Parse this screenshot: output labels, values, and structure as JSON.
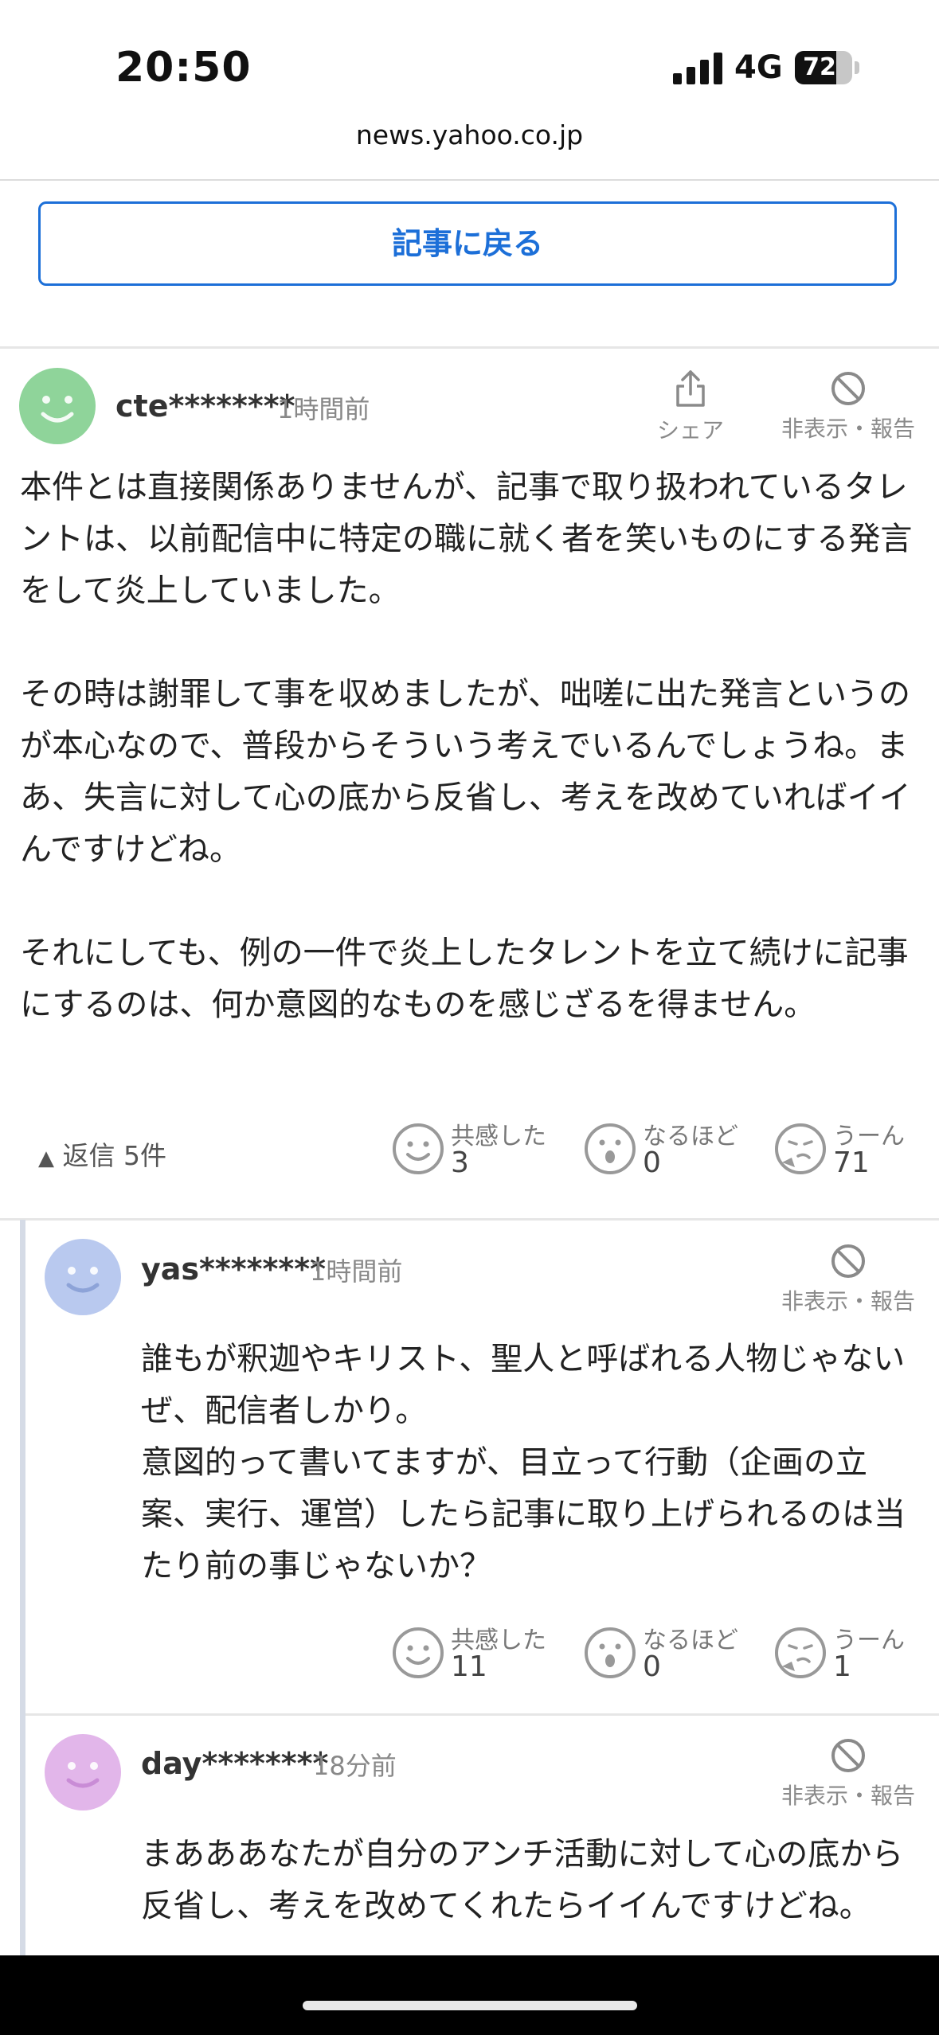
{
  "status_bar": {
    "time": "20:50",
    "network": "4G",
    "battery": "72",
    "battery_level": 0.72
  },
  "browser": {
    "url": "news.yahoo.co.jp"
  },
  "back_button": "記事に戻る",
  "comment": {
    "user": "cte********",
    "time_ago": "1時間前",
    "share_label": "シェア",
    "hide_report_label": "非表示・報告",
    "avatar_color": "#8fd49a",
    "text": "本件とは直接関係ありませんが、記事で取り扱われているタレントは、以前配信中に特定の職に就く者を笑いものにする発言をして炎上していました。\n\nその時は謝罪して事を収めましたが、咄嗟に出た発言というのが本心なので、普段からそういう考えでいるんでしょうね。まあ、失言に対して心の底から反省し、考えを改めていればイイんですけどね。\n\nそれにしても、例の一件で炎上したタレントを立て続けに記事にするのは、何か意図的なものを感じざるを得ません。",
    "replies_label": "返信 5件",
    "reactions": [
      {
        "label": "共感した",
        "count": "3"
      },
      {
        "label": "なるほど",
        "count": "0"
      },
      {
        "label": "うーん",
        "count": "71"
      }
    ]
  },
  "replies": [
    {
      "user": "yas********",
      "time_ago": "1時間前",
      "hide_report_label": "非表示・報告",
      "avatar_color": "#b9c9ef",
      "text": "誰もが釈迦やキリスト、聖人と呼ばれる人物じゃないぜ、配信者しかり。\n意図的って書いてますが、目立って行動（企画の立案、実行、運営）したら記事に取り上げられるのは当たり前の事じゃないか？",
      "reactions": [
        {
          "label": "共感した",
          "count": "11"
        },
        {
          "label": "なるほど",
          "count": "0"
        },
        {
          "label": "うーん",
          "count": "1"
        }
      ]
    },
    {
      "user": "day********",
      "time_ago": "18分前",
      "hide_report_label": "非表示・報告",
      "avatar_color": "#e2b6ea",
      "text": "まあああなたが自分のアンチ活動に対して心の底から反省し、考えを改めてくれたらイイんですけどね。"
    }
  ]
}
